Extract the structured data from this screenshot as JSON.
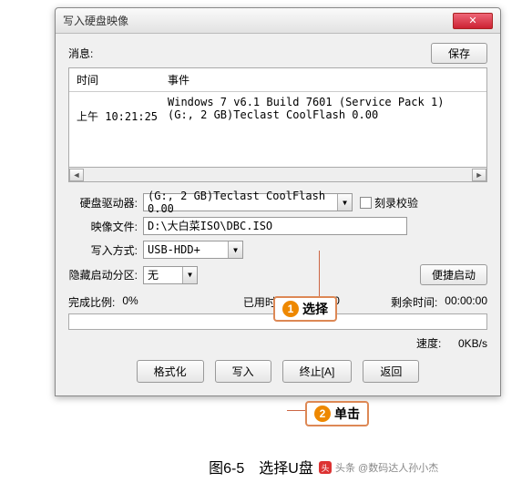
{
  "window": {
    "title": "写入硬盘映像"
  },
  "msg": {
    "label": "消息:",
    "save": "保存"
  },
  "log": {
    "col_time": "时间",
    "col_event": "事件",
    "rows": [
      {
        "time": "",
        "event": "Windows 7 v6.1 Build 7601 (Service Pack 1)"
      },
      {
        "time": "上午 10:21:25",
        "event": "(G:, 2 GB)Teclast CoolFlash      0.00"
      }
    ]
  },
  "form": {
    "drive_label": "硬盘驱动器:",
    "drive_value": "(G:, 2 GB)Teclast CoolFlash      0.00",
    "verify_label": "刻录校验",
    "image_label": "映像文件:",
    "image_value": "D:\\大白菜ISO\\DBC.ISO",
    "method_label": "写入方式:",
    "method_value": "USB-HDD+",
    "hidden_label": "隐藏启动分区:",
    "hidden_value": "无",
    "quick_boot": "便捷启动"
  },
  "status": {
    "done_label": "完成比例:",
    "done_value": "0%",
    "elapsed_label": "已用时间:",
    "elapsed_value": "00:00:00",
    "remain_label": "剩余时间:",
    "remain_value": "00:00:00",
    "speed_label": "速度:",
    "speed_value": "0KB/s"
  },
  "buttons": {
    "format": "格式化",
    "write": "写入",
    "abort": "终止[A]",
    "back": "返回"
  },
  "callouts": {
    "c1_num": "1",
    "c1_text": "选择",
    "c2_num": "2",
    "c2_text": "单击"
  },
  "caption": "图6-5　选择U盘",
  "watermark": "头条 @数码达人孙小杰"
}
